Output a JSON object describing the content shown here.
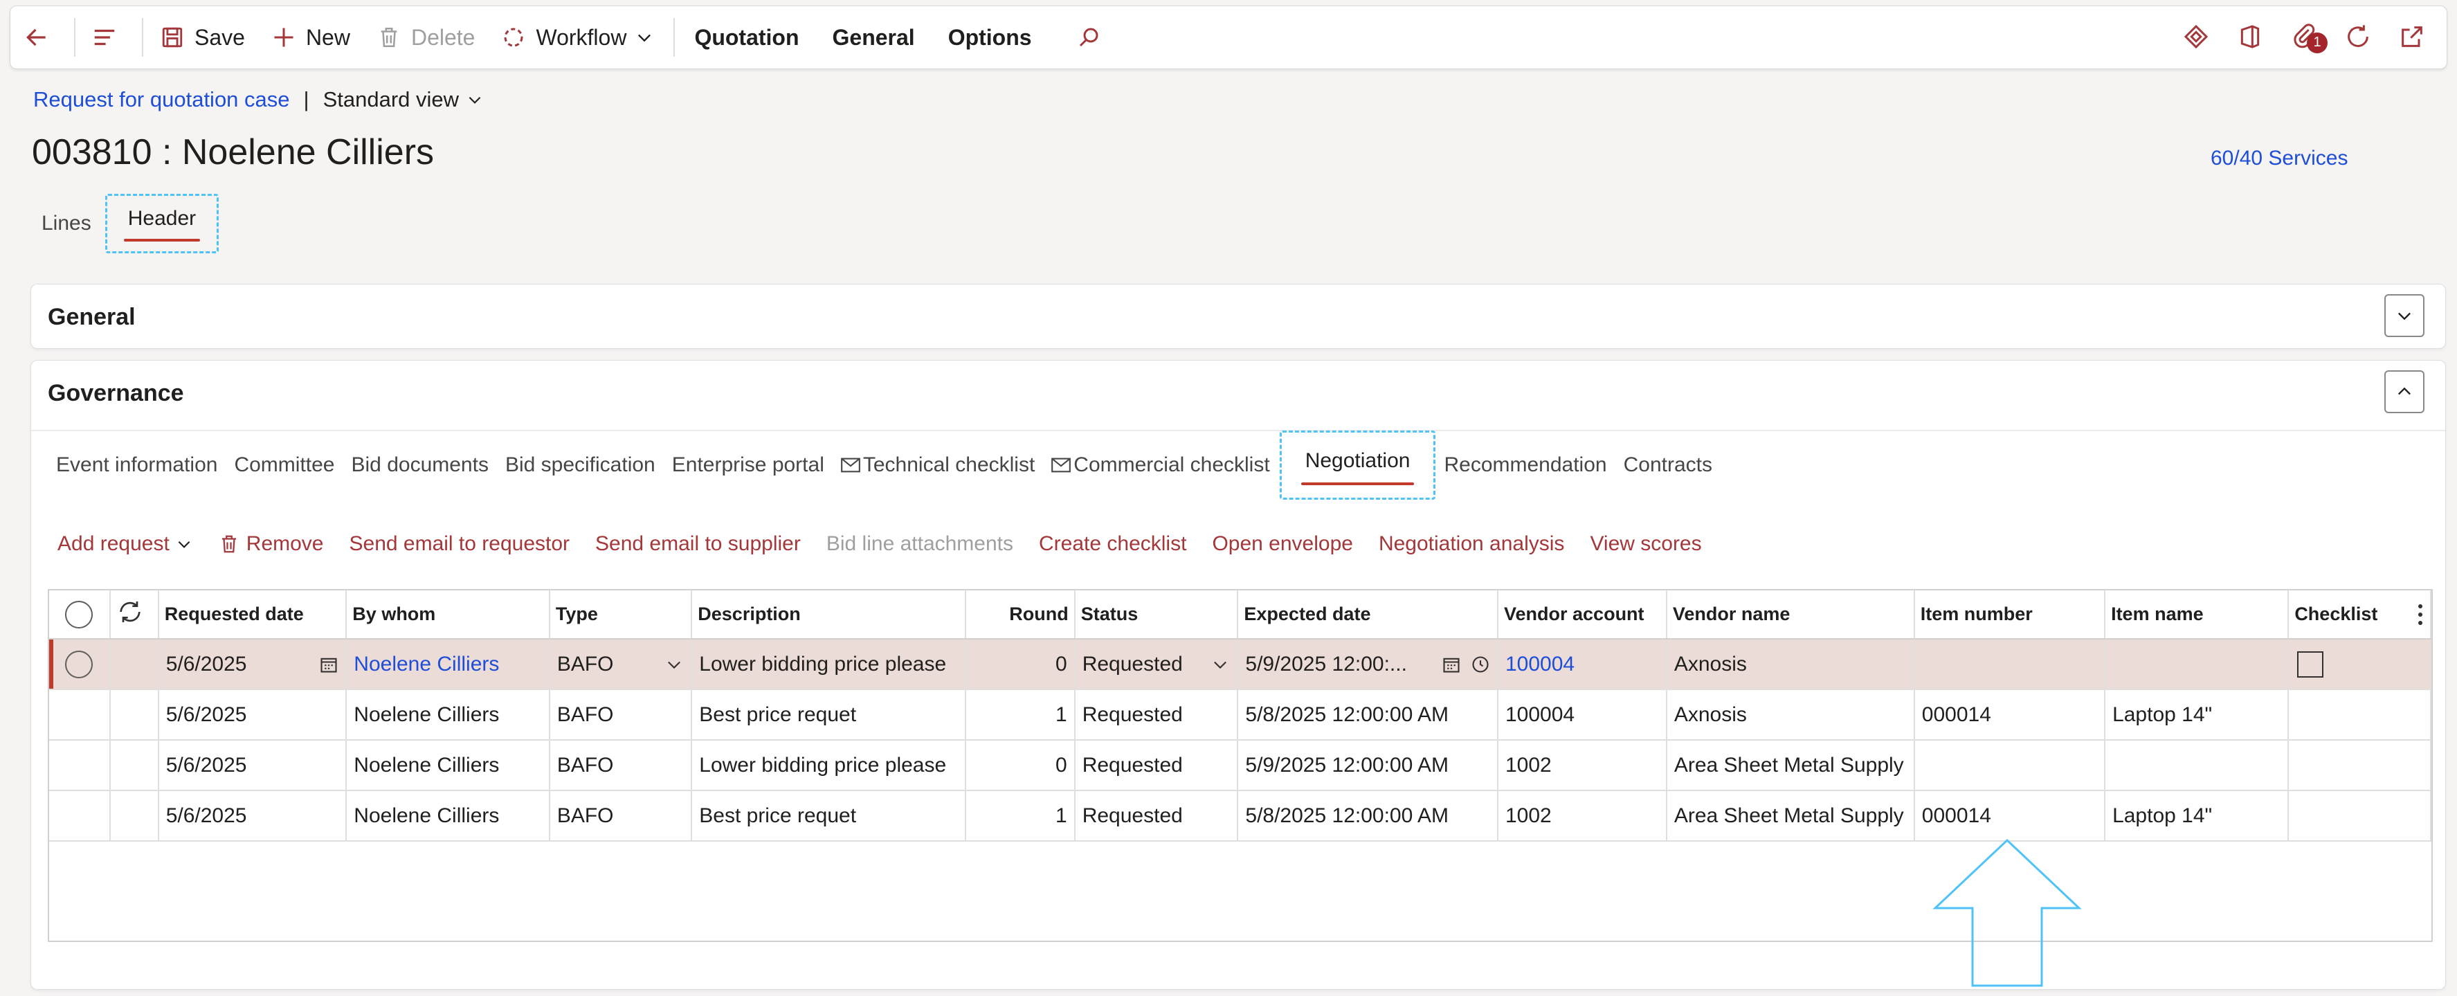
{
  "toolbar": {
    "save_label": "Save",
    "new_label": "New",
    "delete_label": "Delete",
    "workflow_label": "Workflow",
    "quotation_label": "Quotation",
    "general_label": "General",
    "options_label": "Options",
    "notification_count": "1"
  },
  "breadcrumb": {
    "link": "Request for quotation case",
    "separator": "|",
    "view": "Standard view"
  },
  "page": {
    "title": "003810 : Noelene Cilliers",
    "services_link": "60/40 Services"
  },
  "top_tabs": {
    "lines": "Lines",
    "header": "Header"
  },
  "panels": {
    "general": "General",
    "governance": "Governance"
  },
  "sub_tabs": {
    "event_information": "Event information",
    "committee": "Committee",
    "bid_documents": "Bid documents",
    "bid_specification": "Bid specification",
    "enterprise_portal": "Enterprise portal",
    "technical_checklist": "Technical checklist",
    "commercial_checklist": "Commercial checklist",
    "negotiation": "Negotiation",
    "recommendation": "Recommendation",
    "contracts": "Contracts"
  },
  "actions": {
    "add_request": "Add request",
    "remove": "Remove",
    "send_email_requestor": "Send email to requestor",
    "send_email_supplier": "Send email to supplier",
    "bid_line_attachments": "Bid line attachments",
    "create_checklist": "Create checklist",
    "open_envelope": "Open envelope",
    "negotiation_analysis": "Negotiation analysis",
    "view_scores": "View scores"
  },
  "grid": {
    "columns": {
      "requested_date": "Requested date",
      "by_whom": "By whom",
      "type": "Type",
      "description": "Description",
      "round": "Round",
      "status": "Status",
      "expected_date": "Expected date",
      "vendor_account": "Vendor account",
      "vendor_name": "Vendor name",
      "item_number": "Item number",
      "item_name": "Item name",
      "checklist": "Checklist"
    },
    "rows": [
      {
        "requested_date": "5/6/2025",
        "by_whom": "Noelene Cilliers",
        "type": "BAFO",
        "description": "Lower bidding price please",
        "round": "0",
        "status": "Requested",
        "expected_date": "5/9/2025 12:00:...",
        "vendor_account": "100004",
        "vendor_name": "Axnosis",
        "item_number": "",
        "item_name": ""
      },
      {
        "requested_date": "5/6/2025",
        "by_whom": "Noelene Cilliers",
        "type": "BAFO",
        "description": "Best price requet",
        "round": "1",
        "status": "Requested",
        "expected_date": "5/8/2025 12:00:00 AM",
        "vendor_account": "100004",
        "vendor_name": "Axnosis",
        "item_number": "000014",
        "item_name": "Laptop 14\""
      },
      {
        "requested_date": "5/6/2025",
        "by_whom": "Noelene Cilliers",
        "type": "BAFO",
        "description": "Lower bidding price please",
        "round": "0",
        "status": "Requested",
        "expected_date": "5/9/2025 12:00:00 AM",
        "vendor_account": "1002",
        "vendor_name": "Area Sheet Metal Supply",
        "item_number": "",
        "item_name": ""
      },
      {
        "requested_date": "5/6/2025",
        "by_whom": "Noelene Cilliers",
        "type": "BAFO",
        "description": "Best price requet",
        "round": "1",
        "status": "Requested",
        "expected_date": "5/8/2025 12:00:00 AM",
        "vendor_account": "1002",
        "vendor_name": "Area Sheet Metal Supply",
        "item_number": "000014",
        "item_name": "Laptop 14\""
      }
    ]
  },
  "colors": {
    "accent": "#a4373a",
    "link": "#1e4ed8",
    "highlight": "#4fc3f7",
    "selected_row": "#ecdcd7"
  }
}
